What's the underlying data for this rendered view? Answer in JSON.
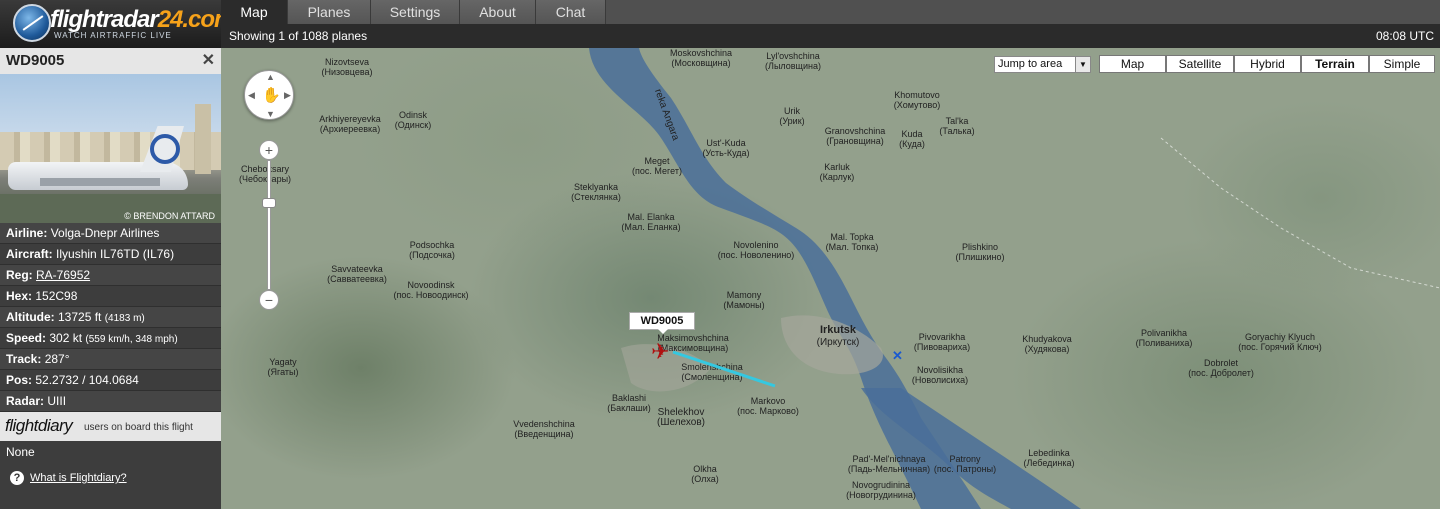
{
  "header": {
    "brand_main": "flightradar",
    "brand_accent": "24.com",
    "tagline": "WATCH AIRTRAFFIC LIVE",
    "status_text": "Showing 1 of 1088 planes",
    "utc_time": "08:08 UTC"
  },
  "tabs": [
    {
      "label": "Map",
      "active": true
    },
    {
      "label": "Planes",
      "active": false
    },
    {
      "label": "Settings",
      "active": false
    },
    {
      "label": "About",
      "active": false
    },
    {
      "label": "Chat",
      "active": false
    }
  ],
  "flight": {
    "callsign": "WD9005",
    "close_glyph": "✕",
    "photo_credit": "© BRENDON ATTARD",
    "rows": [
      {
        "label": "Airline:",
        "value": "Volga-Dnepr Airlines",
        "small": ""
      },
      {
        "label": "Aircraft:",
        "value": "Ilyushin IL76TD (IL76)",
        "small": ""
      },
      {
        "label": "Reg:",
        "value": "RA-76952",
        "small": "",
        "link": true
      },
      {
        "label": "Hex:",
        "value": "152C98",
        "small": ""
      },
      {
        "label": "Altitude:",
        "value": "13725 ft",
        "small": "(4183 m)"
      },
      {
        "label": "Speed:",
        "value": "302 kt",
        "small": "(559 km/h, 348 mph)"
      },
      {
        "label": "Track:",
        "value": "287°",
        "small": ""
      },
      {
        "label": "Pos:",
        "value": "52.2732 / 104.0684",
        "small": ""
      },
      {
        "label": "Radar:",
        "value": "UIII",
        "small": ""
      }
    ],
    "flightdiary_logo": "flightdiary",
    "flightdiary_text": "users on board this flight",
    "flightdiary_value": "None",
    "help_glyph": "?",
    "help_link": "What is Flightdiary?"
  },
  "map": {
    "jump_label": "Jump to area",
    "types": [
      {
        "label": "Map",
        "selected": false
      },
      {
        "label": "Satellite",
        "selected": false
      },
      {
        "label": "Hybrid",
        "selected": false
      },
      {
        "label": "Terrain",
        "selected": true
      },
      {
        "label": "Simple",
        "selected": false
      }
    ],
    "callout": "WD9005",
    "zoom_in": "+",
    "zoom_out": "−",
    "places": [
      {
        "name": "Moskovshchina",
        "alt": "(Московщина)"
      },
      {
        "name": "Lyl'ovshchina",
        "alt": "(Лыловщина)"
      },
      {
        "name": "Nizovtseva",
        "alt": "(Низовцева)"
      },
      {
        "name": "Arkhiyereyevka",
        "alt": "(Архиереевка)"
      },
      {
        "name": "Odinsk",
        "alt": "(Одинск)"
      },
      {
        "name": "Cheboksary",
        "alt": "(Чебоксары)"
      },
      {
        "name": "reka Angara",
        "alt": ""
      },
      {
        "name": "Ust'-Kuda",
        "alt": "(Усть-Куда)"
      },
      {
        "name": "Urik",
        "alt": "(Урик)"
      },
      {
        "name": "Granovshchina",
        "alt": "(Грановщина)"
      },
      {
        "name": "Khomutovo",
        "alt": "(Хомутово)"
      },
      {
        "name": "Kuda",
        "alt": "(Куда)"
      },
      {
        "name": "Tal'ka",
        "alt": "(Талька)"
      },
      {
        "name": "Meget",
        "alt": "(пос. Мегет)"
      },
      {
        "name": "Karluk",
        "alt": "(Карлук)"
      },
      {
        "name": "Steklyanka",
        "alt": "(Стеклянка)"
      },
      {
        "name": "Mal. Elanka",
        "alt": "(Мал. Еланка)"
      },
      {
        "name": "Novolenino",
        "alt": "(пос. Новоленино)"
      },
      {
        "name": "Mal. Topka",
        "alt": "(Мал. Топка)"
      },
      {
        "name": "Plishkino",
        "alt": "(Плишкино)"
      },
      {
        "name": "Podsochka",
        "alt": "(Подсочка)"
      },
      {
        "name": "Savvateevka",
        "alt": "(Савватеевка)"
      },
      {
        "name": "Novoodinsk",
        "alt": "(пос. Новоодинск)"
      },
      {
        "name": "Mamony",
        "alt": "(Мамоны)"
      },
      {
        "name": "Irkutsk",
        "alt": "(Иркутск)",
        "city": true
      },
      {
        "name": "Pivovarikha",
        "alt": "(Пивовариха)"
      },
      {
        "name": "Khudyakova",
        "alt": "(Худякова)"
      },
      {
        "name": "Goryachiy Klyuch",
        "alt": "(пос. Горячий Ключ)"
      },
      {
        "name": "Polivanikha",
        "alt": "(Поливаниха)"
      },
      {
        "name": "Maksimovshchina",
        "alt": "(Максимовщина)"
      },
      {
        "name": "Yagaty",
        "alt": "(Ягаты)"
      },
      {
        "name": "Smolenshchina",
        "alt": "(Смоленщина)"
      },
      {
        "name": "Novolisikha",
        "alt": "(Новолисиха)"
      },
      {
        "name": "Dobrolet",
        "alt": "(пос. Добролет)"
      },
      {
        "name": "Baklashi",
        "alt": "(Баклаши)"
      },
      {
        "name": "Shelekhov",
        "alt": "(Шелехов)"
      },
      {
        "name": "Markovo",
        "alt": "(пос. Марково)"
      },
      {
        "name": "Vvedenshchina",
        "alt": "(Введенщина)"
      },
      {
        "name": "Pad'-Mel'nichnaya",
        "alt": "(Падь-Мельничная)"
      },
      {
        "name": "Patrony",
        "alt": "(пос. Патроны)"
      },
      {
        "name": "Lebedinka",
        "alt": "(Лебединка)"
      },
      {
        "name": "Olkha",
        "alt": "(Олха)"
      },
      {
        "name": "Novogrudinina",
        "alt": "(Новогрудинина)"
      }
    ]
  },
  "colors": {
    "accent": "#f6a21a",
    "trail": "#35c8e0",
    "plane": "#b01010"
  }
}
